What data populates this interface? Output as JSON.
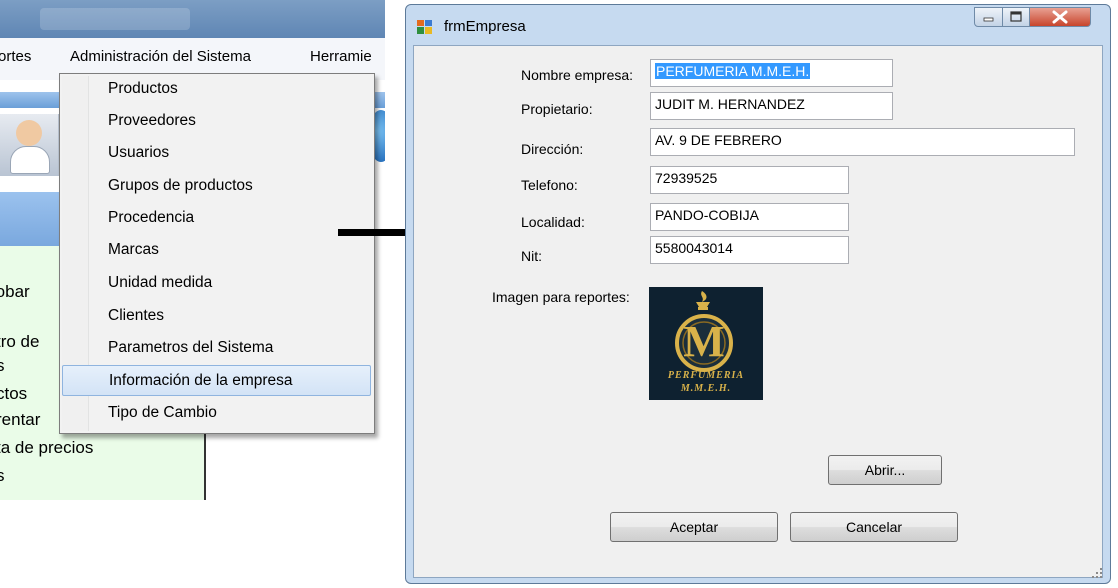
{
  "menubar": {
    "items": [
      "ortes",
      "Administración del Sistema",
      "Herramie"
    ]
  },
  "dropdown": {
    "items": [
      {
        "label": "Productos"
      },
      {
        "label": "Proveedores"
      },
      {
        "label": "Usuarios"
      },
      {
        "label": "Grupos de productos"
      },
      {
        "label": "Procedencia"
      },
      {
        "label": "Marcas"
      },
      {
        "label": "Unidad medida"
      },
      {
        "label": "Clientes"
      },
      {
        "label": "Parametros del Sistema"
      },
      {
        "label": "Información de la empresa",
        "selected": true
      },
      {
        "label": "Tipo de Cambio"
      }
    ]
  },
  "left_panel": {
    "lines": [
      "robar",
      "tro de",
      "s",
      "ctos",
      "rentar",
      "ta de precios",
      "s"
    ]
  },
  "dialog": {
    "title": "frmEmpresa",
    "icon": "form-window-icon",
    "fields": {
      "nombre_empresa": {
        "label": "Nombre empresa:",
        "value": "PERFUMERIA M.M.E.H."
      },
      "propietario": {
        "label": "Propietario:",
        "value": "JUDIT M. HERNANDEZ"
      },
      "direccion": {
        "label": "Dirección:",
        "value": "AV. 9 DE FEBRERO"
      },
      "telefono": {
        "label": "Telefono:",
        "value": "72939525"
      },
      "localidad": {
        "label": "Localidad:",
        "value": "PANDO-COBIJA"
      },
      "nit": {
        "label": "Nit:",
        "value": "5580043014"
      }
    },
    "imagen_label": "Imagen para reportes:",
    "logo": {
      "letter": "M",
      "line1": "PERFUMERIA",
      "line2": "M.M.E.H."
    },
    "buttons": {
      "abrir": "Abrir...",
      "aceptar": "Aceptar",
      "cancelar": "Cancelar"
    }
  },
  "colors": {
    "selection": "#3399ff",
    "dialog_frame": "#c6daf0",
    "close_button": "#c8452c",
    "left_panel": "#eafce8",
    "logo_background": "#0e2130",
    "logo_gold": "#d9b24a"
  }
}
